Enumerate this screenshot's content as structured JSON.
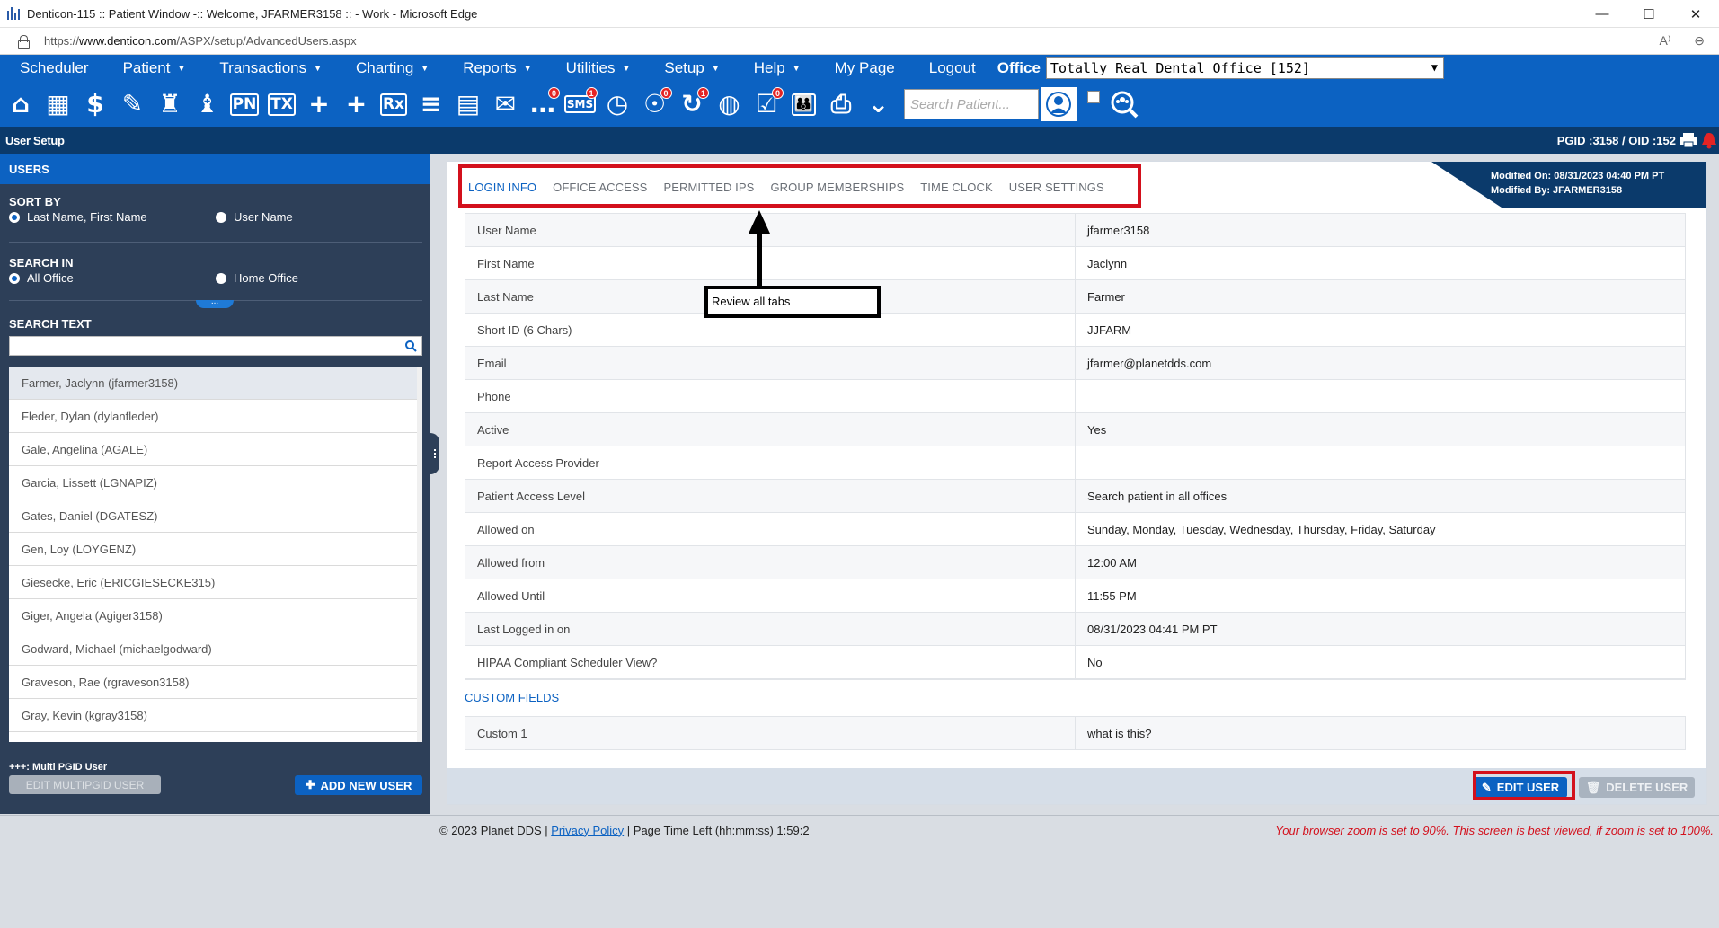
{
  "window": {
    "title": "Denticon-115 :: Patient Window -:: Welcome, JFARMER3158 :: - Work - Microsoft Edge",
    "minimize": "—",
    "maximize": "☐",
    "close": "✕"
  },
  "address": {
    "url_prefix": "https://",
    "url_domain": "www.denticon.com",
    "url_path": "/ASPX/setup/AdvancedUsers.aspx",
    "reader_icon": "A⁾",
    "zoom_icon": "⊖"
  },
  "menu": {
    "items": [
      {
        "label": "Scheduler",
        "caret": false
      },
      {
        "label": "Patient",
        "caret": true
      },
      {
        "label": "Transactions",
        "caret": true
      },
      {
        "label": "Charting",
        "caret": true
      },
      {
        "label": "Reports",
        "caret": true
      },
      {
        "label": "Utilities",
        "caret": true
      },
      {
        "label": "Setup",
        "caret": true
      },
      {
        "label": "Help",
        "caret": true
      },
      {
        "label": "My Page",
        "caret": false
      },
      {
        "label": "Logout",
        "caret": false
      }
    ],
    "office_label": "Office",
    "office_value": "Totally Real Dental Office [152]"
  },
  "toolbar": {
    "icons": [
      {
        "name": "home-icon",
        "glyph": "⌂"
      },
      {
        "name": "calendar-icon",
        "glyph": "▦"
      },
      {
        "name": "dollar-icon",
        "glyph": "$"
      },
      {
        "name": "clipboard-edit-icon",
        "glyph": "✎"
      },
      {
        "name": "tooth-chart-icon",
        "glyph": "♜"
      },
      {
        "name": "tooth-icon",
        "glyph": "♝"
      },
      {
        "name": "pn-icon",
        "glyph": "PN"
      },
      {
        "name": "tx-icon",
        "glyph": "TX"
      },
      {
        "name": "add-patient-icon",
        "glyph": "+"
      },
      {
        "name": "add-family-icon",
        "glyph": "+"
      },
      {
        "name": "rx-icon",
        "glyph": "Rx"
      },
      {
        "name": "notes-icon",
        "glyph": "≡"
      },
      {
        "name": "fax-icon",
        "glyph": "▤"
      },
      {
        "name": "email-icon",
        "glyph": "✉"
      },
      {
        "name": "chat-icon",
        "glyph": "…",
        "badge": "0"
      },
      {
        "name": "sms-icon",
        "glyph": "SMS",
        "badge": "1"
      },
      {
        "name": "clock-icon",
        "glyph": "◷"
      },
      {
        "name": "alerts-icon",
        "glyph": "☉",
        "badge": "0"
      },
      {
        "name": "recall-icon",
        "glyph": "↻",
        "badge": "1"
      },
      {
        "name": "web-icon",
        "glyph": "◍"
      },
      {
        "name": "tasks-icon",
        "glyph": "☑",
        "badge": "0"
      },
      {
        "name": "family-icon",
        "glyph": "👪"
      },
      {
        "name": "print-icon",
        "glyph": "⎙"
      },
      {
        "name": "shield-down-icon",
        "glyph": "⌄"
      }
    ],
    "search_placeholder": "Search Patient..."
  },
  "section": {
    "title": "User Setup",
    "pgid": "PGID :3158  /  OID :152"
  },
  "leftpanel": {
    "header": "USERS",
    "sort_by": "SORT BY",
    "sort_options": [
      "Last Name, First Name",
      "User Name"
    ],
    "search_in": "SEARCH IN",
    "search_in_options": [
      "All Office",
      "Home Office"
    ],
    "search_text": "SEARCH TEXT",
    "search_value": "",
    "users": [
      "Farmer, Jaclynn (jfarmer3158)",
      "Fleder, Dylan (dylanfleder)",
      "Gale, Angelina (AGALE)",
      "Garcia, Lissett (LGNAPIZ)",
      "Gates, Daniel (DGATESZ)",
      "Gen, Loy (LOYGENZ)",
      "Giesecke, Eric (ERICGIESECKE315)",
      "Giger, Angela (Agiger3158)",
      "Godward, Michael (michaelgodward)",
      "Graveson, Rae (rgraveson3158)",
      "Gray, Kevin (kgray3158)"
    ],
    "multi_note": "+++: Multi PGID User",
    "edit_multi": "EDIT MULTIPGID USER",
    "add_new": "ADD NEW USER"
  },
  "main": {
    "tabs": [
      "LOGIN INFO",
      "OFFICE ACCESS",
      "PERMITTED IPS",
      "GROUP MEMBERSHIPS",
      "TIME CLOCK",
      "USER SETTINGS"
    ],
    "modified_on": "Modified On: 08/31/2023 04:40 PM PT",
    "modified_by": "Modified By: JFARMER3158",
    "details": [
      {
        "k": "User Name",
        "v": "jfarmer3158"
      },
      {
        "k": "First Name",
        "v": "Jaclynn"
      },
      {
        "k": "Last Name",
        "v": "Farmer"
      },
      {
        "k": "Short ID (6 Chars)",
        "v": "JJFARM"
      },
      {
        "k": "Email",
        "v": "jfarmer@planetdds.com"
      },
      {
        "k": "Phone",
        "v": ""
      },
      {
        "k": "Active",
        "v": "Yes"
      },
      {
        "k": "Report Access Provider",
        "v": ""
      },
      {
        "k": "Patient Access Level",
        "v": "Search patient in all offices"
      },
      {
        "k": "Allowed on",
        "v": "Sunday, Monday, Tuesday, Wednesday, Thursday, Friday, Saturday"
      },
      {
        "k": "Allowed from",
        "v": "12:00 AM"
      },
      {
        "k": "Allowed Until",
        "v": "11:55 PM"
      },
      {
        "k": "Last Logged in on",
        "v": "08/31/2023 04:41 PM PT"
      },
      {
        "k": "HIPAA Compliant Scheduler View?",
        "v": "No"
      }
    ],
    "custom_header": "CUSTOM FIELDS",
    "custom": [
      {
        "k": "Custom 1",
        "v": "what is this?"
      }
    ],
    "edit_user": "EDIT USER",
    "delete_user": "DELETE USER"
  },
  "annotation": {
    "label": "Review all tabs"
  },
  "footer": {
    "copyright": "© 2023 Planet DDS | ",
    "privacy": "Privacy Policy",
    "time_left": " | Page Time Left (hh:mm:ss) 1:59:2",
    "zoom_notice": "Your browser zoom is set to 90%. This screen is best viewed, if zoom is set to 100%."
  },
  "colors": {
    "brand_blue": "#0c62c2",
    "navy": "#0b3a6b",
    "panel": "#2d3f58",
    "annotation_red": "#d3101c"
  }
}
